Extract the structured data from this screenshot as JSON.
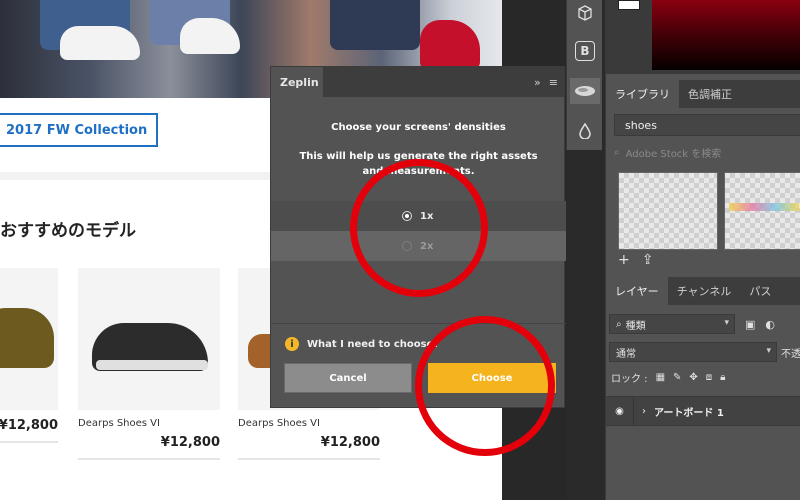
{
  "canvas": {
    "collection_button": "2017 FW Collection",
    "section_title": "おすすめのモデル",
    "products": [
      {
        "name": "",
        "price": "¥12,800"
      },
      {
        "name": "Dearps Shoes VI",
        "price": "¥12,800"
      },
      {
        "name": "Dearps Shoes VI",
        "price": "¥12,800"
      }
    ]
  },
  "zeplin": {
    "tab_label": "Zeplin",
    "heading": "Choose your screens' densities",
    "subtext": "This will help us generate the right assets and measurements.",
    "options": [
      {
        "label": "1x",
        "selected": true
      },
      {
        "label": "2x",
        "selected": false
      }
    ],
    "help_text": "What I need to choose?",
    "cancel_label": "Cancel",
    "choose_label": "Choose",
    "accent_color": "#f5b31d"
  },
  "toolstrip": {
    "icons": [
      "cube-icon",
      "b-icon",
      "zeplin-icon",
      "drop-icon"
    ],
    "b_label": "B"
  },
  "library": {
    "tabs": [
      "ライブラリ",
      "色調補正"
    ],
    "search_value": "shoes",
    "stock_placeholder": "Adobe Stock を検索"
  },
  "layers": {
    "tabs": [
      "レイヤー",
      "チャンネル",
      "パス"
    ],
    "kind_filter": "種類",
    "blend_mode": "通常",
    "opacity_label": "不透",
    "lock_label": "ロック :",
    "layer_name": "アートボード 1"
  }
}
